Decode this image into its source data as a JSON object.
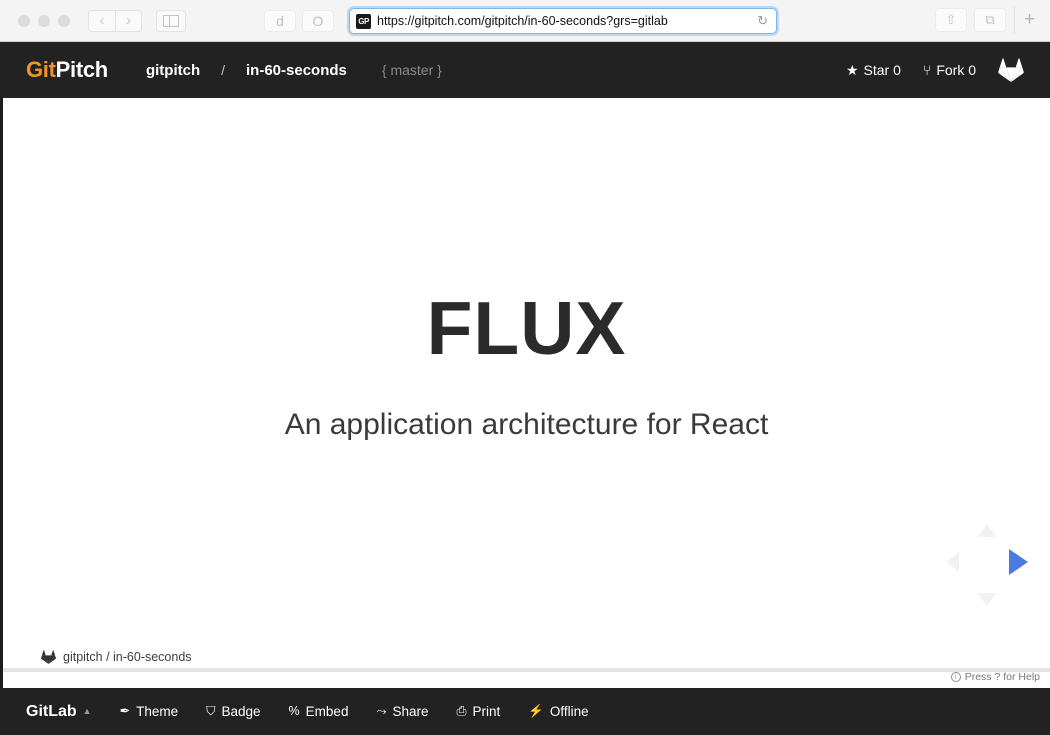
{
  "browser": {
    "url": "https://gitpitch.com/gitpitch/in-60-seconds?grs=gitlab",
    "favicon_label": "GP",
    "back_icon": "‹",
    "forward_icon": "›",
    "sidebar_icon": "sidebar-toggle",
    "ext_icon_1": "d",
    "ext_icon_2": "O",
    "reload_icon": "↻",
    "share_icon": "⇧",
    "tabs_icon": "⧉",
    "newtab_icon": "+"
  },
  "header": {
    "logo_git": "Git",
    "logo_pitch": "Pitch",
    "owner": "gitpitch",
    "separator": "/",
    "repo": "in-60-seconds",
    "branch": "{ master }",
    "star_icon": "★",
    "star_label": "Star 0",
    "fork_icon": "⑂",
    "fork_label": "Fork 0",
    "provider_logo": "gitlab-fox-logo"
  },
  "slide": {
    "title": "FLUX",
    "subtitle": "An application architecture for React",
    "footer_text": "gitpitch / in-60-seconds",
    "footer_icon": "gitlab-fox-icon",
    "help_text": "Press ? for Help",
    "help_icon": "ⓘ",
    "nav": {
      "up": "▲",
      "down": "▼",
      "left": "◀",
      "right": "▶",
      "active_color": "#4a7ce0",
      "inactive_color": "#f2f2f2"
    }
  },
  "toolbar": {
    "provider_label": "GitLab",
    "provider_caret": "▲",
    "items": [
      {
        "icon": "✒",
        "label": "Theme",
        "name": "theme"
      },
      {
        "icon": "⛉",
        "label": "Badge",
        "name": "badge"
      },
      {
        "icon": "%",
        "label": "Embed",
        "name": "embed"
      },
      {
        "icon": "⤳",
        "label": "Share",
        "name": "share"
      },
      {
        "icon": "⎙",
        "label": "Print",
        "name": "print"
      },
      {
        "icon": "⚡",
        "label": "Offline",
        "name": "offline"
      }
    ]
  },
  "colors": {
    "header_bg": "#222222",
    "accent_orange": "#f0932b",
    "slide_bg": "#ffffff",
    "nav_active": "#4a7ce0",
    "chrome_bg": "#f4f4f4"
  }
}
